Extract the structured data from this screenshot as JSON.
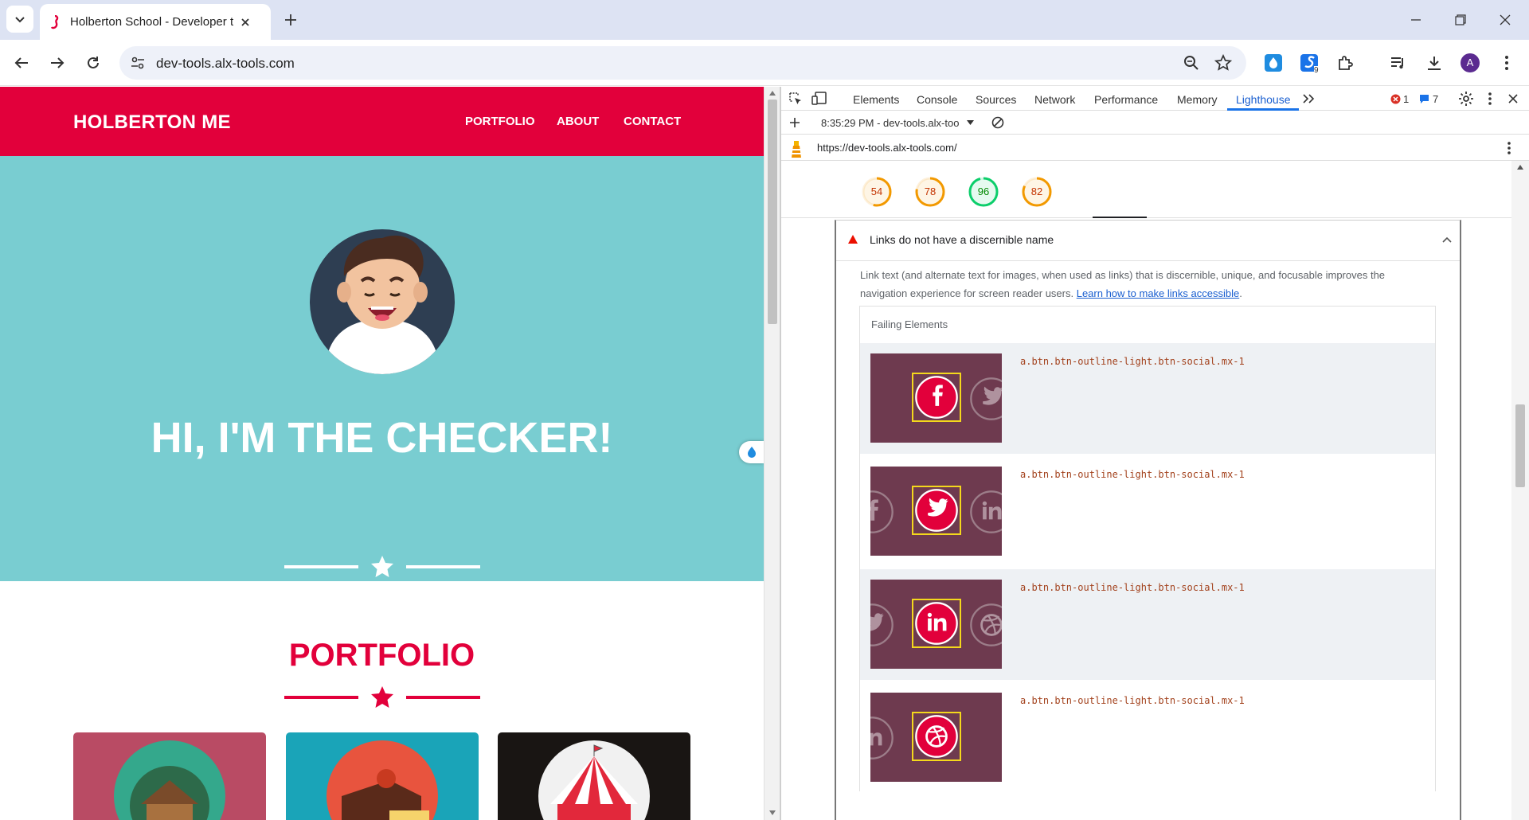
{
  "browser": {
    "tab_title": "Holberton School - Developer t",
    "url": "dev-tools.alx-tools.com",
    "profile_initial": "A",
    "extension_badge": "9"
  },
  "page": {
    "brand": "HOLBERTON ME",
    "nav": [
      "PORTFOLIO",
      "ABOUT",
      "CONTACT"
    ],
    "hero_title": "HI, I'M THE CHECKER!",
    "portfolio_title": "PORTFOLIO",
    "colors": {
      "primary": "#e2003b",
      "hero_bg": "#79cdd1"
    }
  },
  "devtools": {
    "tabs": [
      "Elements",
      "Console",
      "Sources",
      "Network",
      "Performance",
      "Memory",
      "Lighthouse"
    ],
    "active_tab": "Lighthouse",
    "error_count": "1",
    "message_count": "7",
    "report_selector": "8:35:29 PM - dev-tools.alx-too",
    "report_url": "https://dev-tools.alx-tools.com/",
    "scores": [
      {
        "value": "54",
        "color": "#f29900",
        "fraction": 0.54
      },
      {
        "value": "78",
        "color": "#f29900",
        "fraction": 0.78
      },
      {
        "value": "96",
        "color": "#0cce6b",
        "fraction": 0.96
      },
      {
        "value": "82",
        "color": "#f29900",
        "fraction": 0.82
      }
    ],
    "audit": {
      "title": "Links do not have a discernible name",
      "description": "Link text (and alternate text for images, when used as links) that is discernible, unique, and focusable improves the navigation experience for screen reader users.",
      "link_text": "Learn how to make links accessible",
      "failing_header": "Failing Elements",
      "items": [
        {
          "selector": "a.btn.btn-outline-light.btn-social.mx-1",
          "icon": "facebook-icon"
        },
        {
          "selector": "a.btn.btn-outline-light.btn-social.mx-1",
          "icon": "twitter-icon"
        },
        {
          "selector": "a.btn.btn-outline-light.btn-social.mx-1",
          "icon": "linkedin-icon"
        },
        {
          "selector": "a.btn.btn-outline-light.btn-social.mx-1",
          "icon": "dribbble-icon"
        }
      ]
    }
  }
}
